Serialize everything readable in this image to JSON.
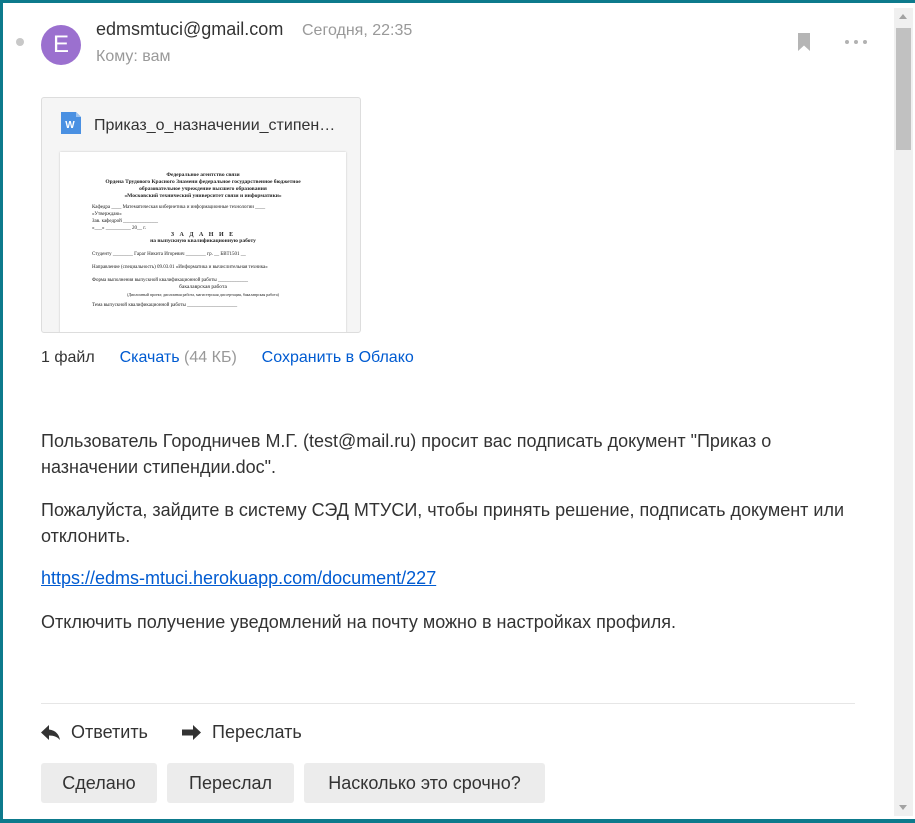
{
  "message": {
    "avatar_letter": "E",
    "sender": "edmsmtuci@gmail.com",
    "date": "Сегодня, 22:35",
    "to": "Кому: вам"
  },
  "attachment": {
    "file_name": "Приказ_о_назначении_стипен…",
    "icon": "word-doc-icon",
    "count_label": "1 файл",
    "download_label": "Скачать",
    "download_size": "(44 КБ)",
    "save_cloud_label": "Сохранить в Облако",
    "preview": {
      "header_lines": [
        "Федеральное агентство связи",
        "Ордена Трудового Красного Знамени федеральное государственное бюджетное",
        "образовательное учреждение высшего образования",
        "«Московский технический университет связи и информатики»"
      ],
      "lines": [
        "Кафедра ____ Математическая кибернетика и информационные технологии ____",
        "«Утверждаю»",
        "Зав. кафедрой ______________",
        "«___» __________ 20__ г.",
        "Студенту ________ Гараг Никита Игоревич ________ гр. __ БВТ1501 __",
        "Направление (специальность) 09.03.01 «Информатика и вычислительная техника»",
        "Форма выполнения выпускной квалификационной работы ____________",
        "бакалаврская работа",
        "(Дипломный проект, дипломная работа, магистерская диссертация, бакалаврская работа)",
        "Тема выпускной квалификационной работы ____________________"
      ],
      "title_word": "З А Д А Н И Е",
      "title_sub": "на выпускную квалификационную работу"
    }
  },
  "body": {
    "paragraph1": "Пользователь Городничев М.Г. (test@mail.ru) просит вас подписать документ \"Приказ о назначении стипендии.doc\".",
    "paragraph2": "Пожалуйста, зайдите в систему СЭД МТУСИ, чтобы принять решение, подписать документ или отклонить.",
    "link": "https://edms-mtuci.herokuapp.com/document/227",
    "paragraph3": "Отключить получение уведомлений на почту можно в настройках профиля."
  },
  "actions": {
    "reply": "Ответить",
    "forward": "Переслать"
  },
  "quick_replies": [
    "Сделано",
    "Переслал",
    "Насколько это срочно?"
  ],
  "colors": {
    "avatar": "#9b70cf",
    "link": "#005bd1",
    "frame": "#0d7a8c"
  }
}
